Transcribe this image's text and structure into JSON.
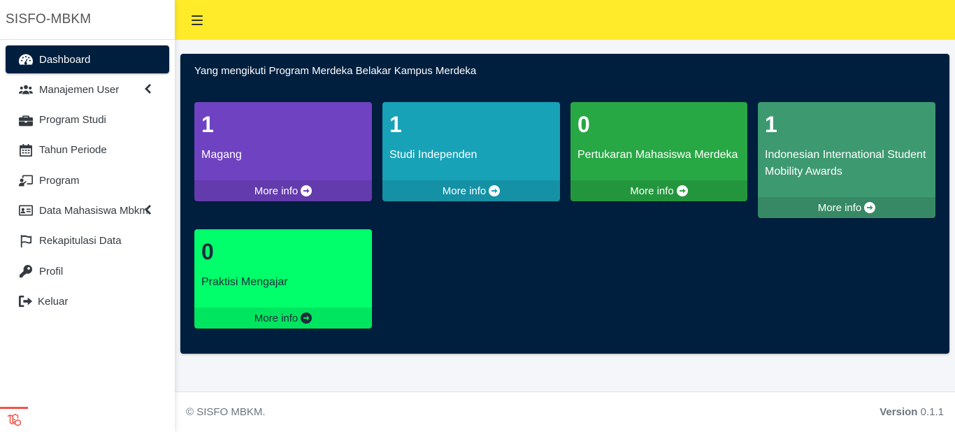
{
  "brand": "SISFO-MBKM",
  "sidebar": {
    "items": [
      {
        "label": "Dashboard",
        "icon": "tachometer-icon",
        "active": true
      },
      {
        "label": "Manajemen User",
        "icon": "users-icon",
        "has_submenu": true
      },
      {
        "label": "Program Studi",
        "icon": "briefcase-icon"
      },
      {
        "label": "Tahun Periode",
        "icon": "calendar-icon"
      },
      {
        "label": "Program",
        "icon": "chalkboard-teacher-icon"
      },
      {
        "label": "Data Mahasiswa Mbkm",
        "icon": "id-card-icon",
        "has_submenu": true
      },
      {
        "label": "Rekapitulasi Data",
        "icon": "flag-icon"
      },
      {
        "label": "Profil",
        "icon": "key-icon"
      },
      {
        "label": "Keluar",
        "icon": "sign-out-icon"
      }
    ]
  },
  "main": {
    "title": "Yang mengikuti Program Merdeka Belakar Kampus Merdeka",
    "boxes": [
      {
        "count": "1",
        "label": "Magang",
        "footer": "More info",
        "color": "#6f42c1"
      },
      {
        "count": "1",
        "label": "Studi Independen",
        "footer": "More info",
        "color": "#17a2b8"
      },
      {
        "count": "0",
        "label": "Pertukaran Mahasiswa Merdeka",
        "footer": "More info",
        "color": "#28a745"
      },
      {
        "count": "1",
        "label": "Indonesian International Student Mobility Awards",
        "footer": "More info",
        "color": "#3d9970"
      },
      {
        "count": "0",
        "label": "Praktisi Mengajar",
        "footer": "More info",
        "color": "#00ff6a"
      }
    ]
  },
  "footer": {
    "copyright": "© SISFO MBKM.",
    "version_label": "Version",
    "version_number": "0.1.1"
  },
  "colors": {
    "topbar": "#ffeb2a",
    "sidebar_active": "#001f3f",
    "main_card": "#001f3f"
  }
}
